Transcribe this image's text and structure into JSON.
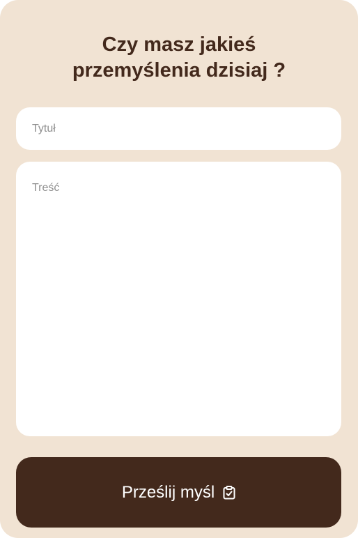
{
  "form": {
    "heading_line1": "Czy masz jakieś",
    "heading_line2": "przemyślenia dzisiaj ?",
    "title_placeholder": "Tytuł",
    "content_placeholder": "Treść",
    "submit_label": "Prześlij myśl",
    "submit_icon": "clipboard-check-icon"
  },
  "colors": {
    "background": "#f1e3d3",
    "accent": "#43291c",
    "field": "#ffffff",
    "placeholder": "#8f8f8f"
  }
}
